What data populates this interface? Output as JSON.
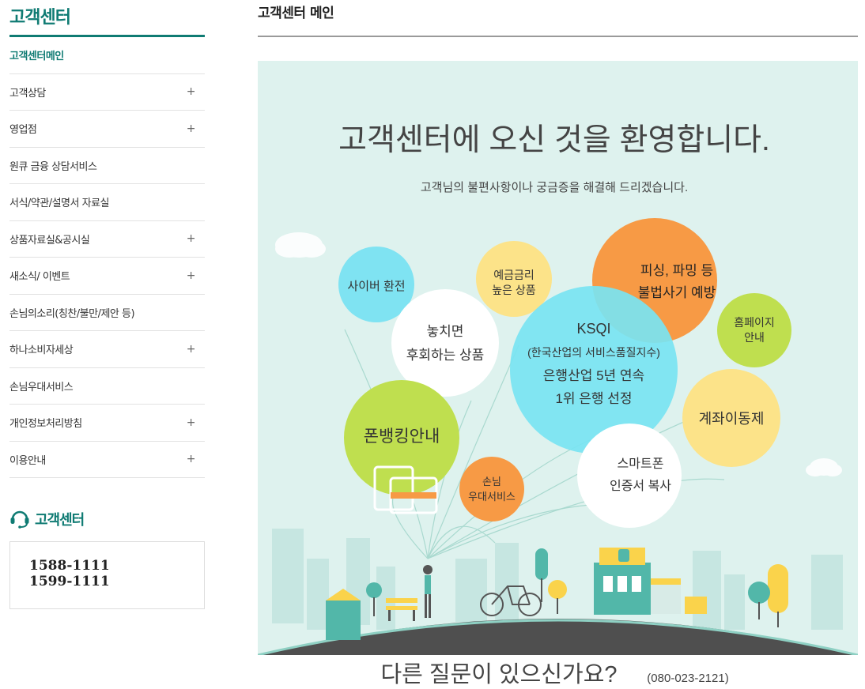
{
  "sidebar": {
    "title": "고객센터",
    "items": [
      {
        "label": "고객센터메인",
        "expandable": false,
        "active": true
      },
      {
        "label": "고객상담",
        "expandable": true
      },
      {
        "label": "영업점",
        "expandable": true
      },
      {
        "label": "원큐 금융 상담서비스",
        "expandable": false
      },
      {
        "label": "서식/약관/설명서 자료실",
        "expandable": false
      },
      {
        "label": "상품자료실&공시실",
        "expandable": true
      },
      {
        "label": "새소식/ 이벤트",
        "expandable": true
      },
      {
        "label": "손님의소리(칭찬/불만/제안 등)",
        "expandable": false
      },
      {
        "label": "하나소비자세상",
        "expandable": true
      },
      {
        "label": "손님우대서비스",
        "expandable": false
      },
      {
        "label": "개인정보처리방침",
        "expandable": true
      },
      {
        "label": "이용안내",
        "expandable": true
      }
    ],
    "plus": "+",
    "cs_title": "고객센터",
    "phones": [
      "1588-1111",
      "1599-1111"
    ]
  },
  "main": {
    "page_title": "고객센터 메인",
    "banner": {
      "headline": "고객센터에 오신 것을 환영합니다.",
      "subtitle": "고객님의 불편사항이나 궁금증을 해결해 드리겠습니다.",
      "bubbles": {
        "cyber": "사이버 환전",
        "deposit": [
          "예금금리",
          "높은 상품"
        ],
        "missed": [
          "놓치면",
          "후회하는 상품"
        ],
        "ksqi": [
          "KSQI",
          "(한국산업의 서비스품질지수)",
          "은행산업 5년 연속",
          "1위 은행 선정"
        ],
        "phishing": [
          "피싱, 파밍 등",
          "불법사기 예방"
        ],
        "homepage": [
          "홈페이지",
          "안내"
        ],
        "transfer": "계좌이동제",
        "phonebank": "폰뱅킹안내",
        "vip": [
          "손님",
          "우대서비스"
        ],
        "smartphone": [
          "스마트폰",
          "인증서 복사"
        ]
      },
      "footer_question": "다른 질문이 있으신가요?",
      "footer_phone": "(080-023-2121)",
      "colors": {
        "bg": "#def2ee",
        "cyan": "#7fe3f2",
        "yellow": "#fce389",
        "orange": "#f79a45",
        "green": "#bfdf4f",
        "ksqi": "#78e4f2"
      }
    }
  }
}
